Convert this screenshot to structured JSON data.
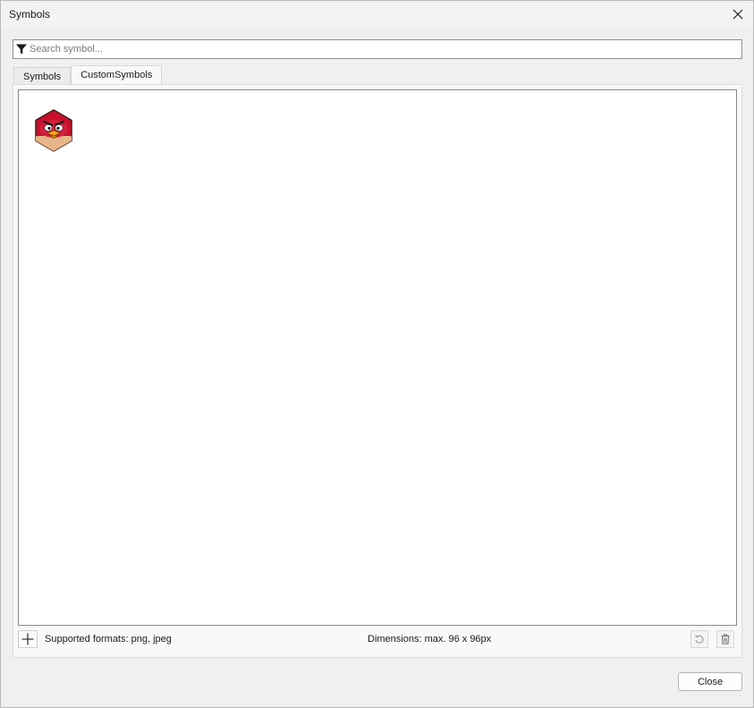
{
  "window": {
    "title": "Symbols"
  },
  "search": {
    "placeholder": "Search symbol...",
    "value": ""
  },
  "tabs": [
    {
      "label": "Symbols",
      "active": false
    },
    {
      "label": "CustomSymbols",
      "active": true
    }
  ],
  "symbols": [
    {
      "name": "angry-bird-red-icon"
    }
  ],
  "footer": {
    "formats_text": "Supported formats: png, jpeg",
    "dimensions_text": "Dimensions: max. 96 x 96px"
  },
  "buttons": {
    "close_label": "Close"
  },
  "colors": {
    "window_bg": "#f0f0f0",
    "panel_bg": "#ffffff",
    "border": "#8a8a8a"
  }
}
